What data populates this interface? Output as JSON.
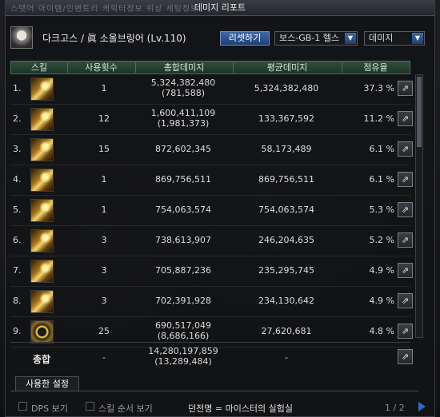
{
  "window": {
    "title": "데미지 리포트",
    "ghost_tabs": "스탯어   아이템/인벤토리   캐릭터정보   위상   세팅정보"
  },
  "header": {
    "character": "다크고스 / 眞 소울브링어 (Lv.110)",
    "reset_label": "리셋하기",
    "boss_select": "보스-GB-1 헬스",
    "metric_select": "데미지"
  },
  "columns": {
    "skill": "스킬",
    "uses": "사용횟수",
    "total": "총합데미지",
    "avg": "평균데미지",
    "share": "점유율"
  },
  "rows": [
    {
      "rank": "1.",
      "uses": "1",
      "total": "5,324,382,480",
      "total_sub": "(781,588)",
      "avg": "5,324,382,480",
      "share": "37.3 %"
    },
    {
      "rank": "2.",
      "uses": "12",
      "total": "1,600,411,109",
      "total_sub": "(1,981,373)",
      "avg": "133,367,592",
      "share": "11.2 %"
    },
    {
      "rank": "3.",
      "uses": "15",
      "total": "872,602,345",
      "total_sub": "",
      "avg": "58,173,489",
      "share": "6.1 %"
    },
    {
      "rank": "4.",
      "uses": "1",
      "total": "869,756,511",
      "total_sub": "",
      "avg": "869,756,511",
      "share": "6.1 %"
    },
    {
      "rank": "5.",
      "uses": "1",
      "total": "754,063,574",
      "total_sub": "",
      "avg": "754,063,574",
      "share": "5.3 %"
    },
    {
      "rank": "6.",
      "uses": "3",
      "total": "738,613,907",
      "total_sub": "",
      "avg": "246,204,635",
      "share": "5.2 %"
    },
    {
      "rank": "7.",
      "uses": "3",
      "total": "705,887,236",
      "total_sub": "",
      "avg": "235,295,745",
      "share": "4.9 %"
    },
    {
      "rank": "8.",
      "uses": "3",
      "total": "702,391,928",
      "total_sub": "",
      "avg": "234,130,642",
      "share": "4.9 %"
    },
    {
      "rank": "9.",
      "uses": "25",
      "total": "690,517,049",
      "total_sub": "(8,686,166)",
      "avg": "27,620,681",
      "share": "4.8 %"
    }
  ],
  "total": {
    "label": "총합",
    "uses": "-",
    "total": "14,280,197,859",
    "total_sub": "(13,289,484)",
    "avg": "-"
  },
  "settings_tab": "사용한 설정",
  "bottom": {
    "dps_label": "DPS 보기",
    "skill_order_label": "스킬 순서 보기",
    "dungeon": "던전명 = 마이스터의 실험실",
    "page": "1 / 2"
  },
  "colors": {
    "accent_blue": "#2f6ac9",
    "header_green": "#2f4f3d"
  },
  "icons": {
    "share": "share-icon",
    "next": "next-page-icon",
    "dropdown": "chevron-down-icon"
  }
}
